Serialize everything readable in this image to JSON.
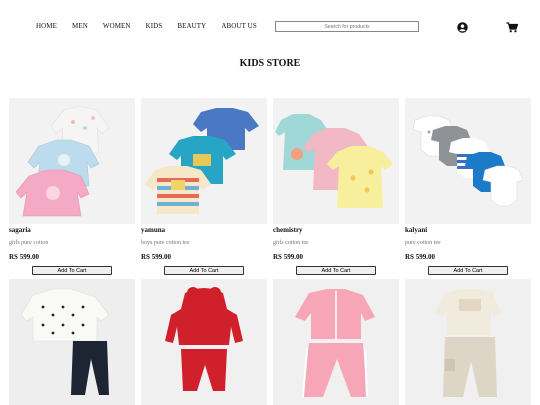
{
  "nav": {
    "items": [
      "HOME",
      "MEN",
      "WOMEN",
      "KIDS",
      "BEAUTY",
      "ABOUT US"
    ]
  },
  "search": {
    "placeholder": "Search for products"
  },
  "icons": {
    "user": "user-circle-icon",
    "cart": "shopping-cart-icon"
  },
  "page": {
    "title": "KIDS STORE"
  },
  "products": [
    {
      "name": "sagaria",
      "desc": "girls pure cotton",
      "price": "RS 599.00",
      "button": "Add To Cart"
    },
    {
      "name": "yamuna",
      "desc": "boys pure cotton tee",
      "price": "RS 599.00",
      "button": "Add To Cart"
    },
    {
      "name": "chemistry",
      "desc": "girls cotton tee",
      "price": "RS 599.00",
      "button": "Add To Cart"
    },
    {
      "name": "kalyani",
      "desc": "pure cotton tee",
      "price": "RS 599.00",
      "button": "Add To Cart"
    }
  ],
  "colors": {
    "accent": "#111111",
    "image_bg": "#f4f3f3",
    "desc_text": "#777777"
  }
}
